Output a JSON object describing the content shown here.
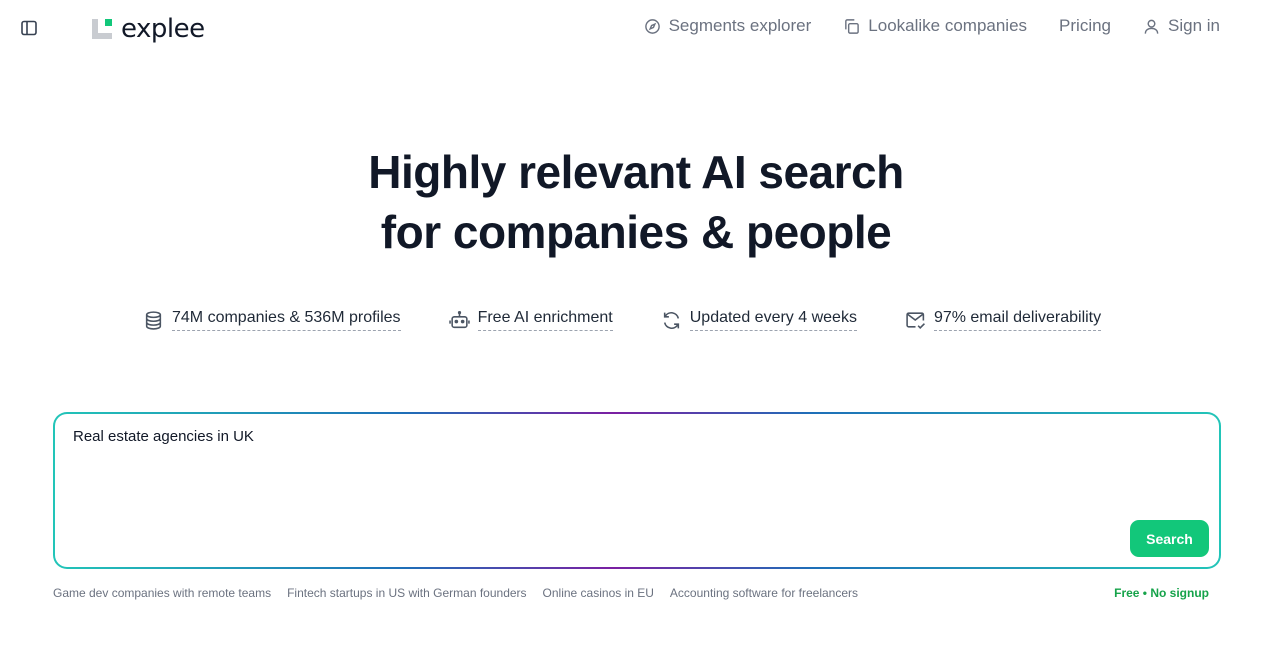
{
  "header": {
    "logo_text": "explee",
    "nav": [
      {
        "label": "Segments explorer",
        "icon": "compass-icon"
      },
      {
        "label": "Lookalike companies",
        "icon": "copy-icon"
      },
      {
        "label": "Pricing",
        "icon": ""
      },
      {
        "label": "Sign in",
        "icon": "user-icon"
      }
    ]
  },
  "hero": {
    "line1": "Highly relevant AI search",
    "line2": "for companies & people"
  },
  "features": [
    {
      "label": "74M companies & 536M profiles",
      "icon": "database-icon"
    },
    {
      "label": "Free AI enrichment",
      "icon": "robot-icon"
    },
    {
      "label": "Updated every 4 weeks",
      "icon": "refresh-icon"
    },
    {
      "label": "97% email deliverability",
      "icon": "mail-check-icon"
    }
  ],
  "search": {
    "value": "Real estate agencies in UK",
    "button_label": "Search"
  },
  "suggestions": [
    "Game dev companies with remote teams",
    "Fintech startups in US with German founders",
    "Online casinos in EU",
    "Accounting software for freelancers"
  ],
  "free_note": "Free • No signup",
  "colors": {
    "accent_green": "#12c77a",
    "free_note_green": "#16a34a",
    "heading": "#111827",
    "muted": "#6b7280"
  }
}
